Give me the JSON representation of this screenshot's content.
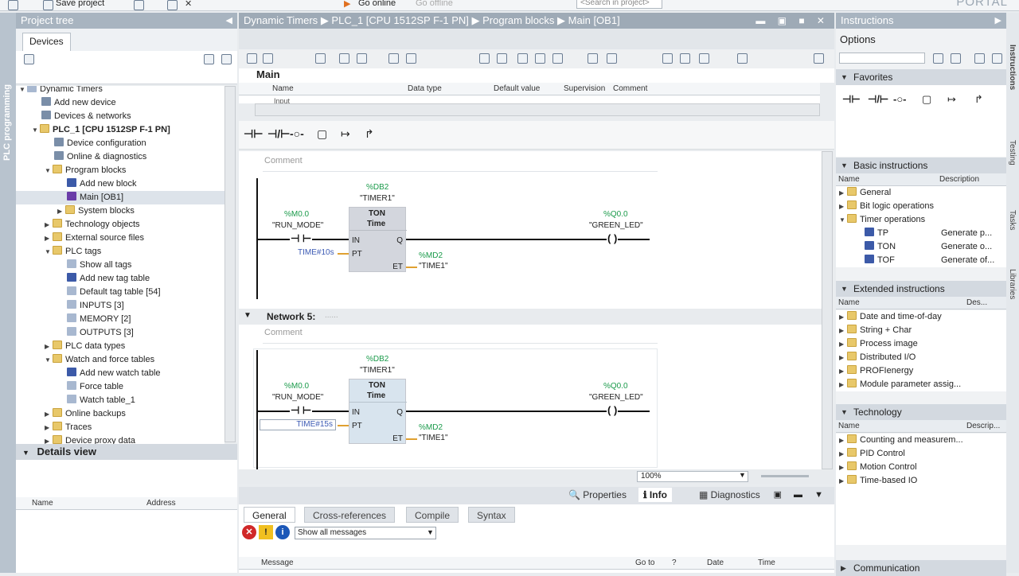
{
  "topbar": {
    "save_label": "Save project",
    "go_online": "Go online",
    "go_offline": "Go offline",
    "search_placeholder": "<Search in project>",
    "portal": "PORTAL"
  },
  "left_strip": {
    "label": "PLC programming"
  },
  "project_tree": {
    "title": "Project tree",
    "devices_tab": "Devices",
    "items": [
      {
        "label": "Dynamic Timers"
      },
      {
        "label": "Add new device"
      },
      {
        "label": "Devices & networks"
      },
      {
        "label": "PLC_1 [CPU 1512SP F-1 PN]"
      },
      {
        "label": "Device configuration"
      },
      {
        "label": "Online & diagnostics"
      },
      {
        "label": "Program blocks"
      },
      {
        "label": "Add new block"
      },
      {
        "label": "Main [OB1]"
      },
      {
        "label": "System blocks"
      },
      {
        "label": "Technology objects"
      },
      {
        "label": "External source files"
      },
      {
        "label": "PLC tags"
      },
      {
        "label": "Show all tags"
      },
      {
        "label": "Add new tag table"
      },
      {
        "label": "Default tag table [54]"
      },
      {
        "label": "INPUTS [3]"
      },
      {
        "label": "MEMORY [2]"
      },
      {
        "label": "OUTPUTS [3]"
      },
      {
        "label": "PLC data types"
      },
      {
        "label": "Watch and force tables"
      },
      {
        "label": "Add new watch table"
      },
      {
        "label": "Force table"
      },
      {
        "label": "Watch table_1"
      },
      {
        "label": "Online backups"
      },
      {
        "label": "Traces"
      },
      {
        "label": "Device proxy data"
      }
    ]
  },
  "details_view": {
    "title": "Details view",
    "col_name": "Name",
    "col_address": "Address"
  },
  "editor": {
    "breadcrumb": [
      "Dynamic Timers",
      "PLC_1 [CPU 1512SP F-1 PN]",
      "Program blocks",
      "Main [OB1]"
    ],
    "block_name": "Main",
    "interface_cols": [
      "Name",
      "Data type",
      "Default value",
      "Supervision",
      "Comment"
    ],
    "interface_row": "Input",
    "comment_label": "Comment",
    "network5_title": "Network 5:",
    "network5_dots": "......",
    "zoom": "100%",
    "net4": {
      "db": "%DB2",
      "db_name": "\"TIMER1\"",
      "in_addr": "%M0.0",
      "in_name": "\"RUN_MODE\"",
      "ton": "TON",
      "time": "Time",
      "pin_in": "IN",
      "pin_pt": "PT",
      "pin_q": "Q",
      "pin_et": "ET",
      "pt_val": "TIME#10s",
      "et_addr": "%MD2",
      "et_name": "\"TIME1\"",
      "out_addr": "%Q0.0",
      "out_name": "\"GREEN_LED\""
    },
    "net5": {
      "db": "%DB2",
      "db_name": "\"TIMER1\"",
      "in_addr": "%M0.0",
      "in_name": "\"RUN_MODE\"",
      "ton": "TON",
      "time": "Time",
      "pin_in": "IN",
      "pin_pt": "PT",
      "pin_q": "Q",
      "pin_et": "ET",
      "pt_val": "TIME#15s",
      "et_addr": "%MD2",
      "et_name": "\"TIME1\"",
      "out_addr": "%Q0.0",
      "out_name": "\"GREEN_LED\""
    }
  },
  "inspector": {
    "properties": "Properties",
    "info": "Info",
    "diagnostics": "Diagnostics",
    "tabs": [
      "General",
      "Cross-references",
      "Compile",
      "Syntax"
    ],
    "filter": "Show all messages",
    "cols": [
      "Message",
      "Go to",
      "?",
      "Date",
      "Time"
    ]
  },
  "instructions": {
    "title": "Instructions",
    "options": "Options",
    "favorites": "Favorites",
    "basic": {
      "title": "Basic instructions",
      "col_name": "Name",
      "col_desc": "Description",
      "items": [
        {
          "label": "General",
          "desc": ""
        },
        {
          "label": "Bit logic operations",
          "desc": ""
        },
        {
          "label": "Timer operations",
          "desc": ""
        },
        {
          "label": "TP",
          "desc": "Generate p..."
        },
        {
          "label": "TON",
          "desc": "Generate o..."
        },
        {
          "label": "TOF",
          "desc": "Generate of..."
        }
      ]
    },
    "extended": {
      "title": "Extended instructions",
      "col_name": "Name",
      "col_desc": "Des...",
      "items": [
        "Date and time-of-day",
        "String + Char",
        "Process image",
        "Distributed I/O",
        "PROFIenergy",
        "Module parameter assig..."
      ]
    },
    "technology": {
      "title": "Technology",
      "col_name": "Name",
      "col_desc": "Descrip...",
      "items": [
        "Counting and measurem...",
        "PID Control",
        "Motion Control",
        "Time-based IO"
      ]
    },
    "communication": "Communication"
  },
  "right_strip": [
    "Instructions",
    "Testing",
    "Tasks",
    "Libraries"
  ]
}
